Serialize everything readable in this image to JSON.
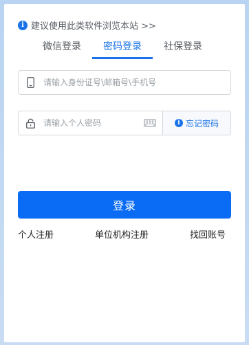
{
  "notice": {
    "text": "建议使用此类软件浏览本站 >>"
  },
  "tabs": [
    {
      "label": "微信登录",
      "active": false
    },
    {
      "label": "密码登录",
      "active": true
    },
    {
      "label": "社保登录",
      "active": false
    }
  ],
  "form": {
    "id_placeholder": "请输入身份证号\\邮箱号\\手机号",
    "password_placeholder": "请输入个人密码",
    "forgot_label": "忘记密码",
    "login_label": "登录"
  },
  "links": {
    "personal_register": "个人注册",
    "org_register": "单位机构注册",
    "recover_account": "找回账号"
  },
  "colors": {
    "accent": "#1a73e8",
    "button": "#0a6cf5"
  }
}
